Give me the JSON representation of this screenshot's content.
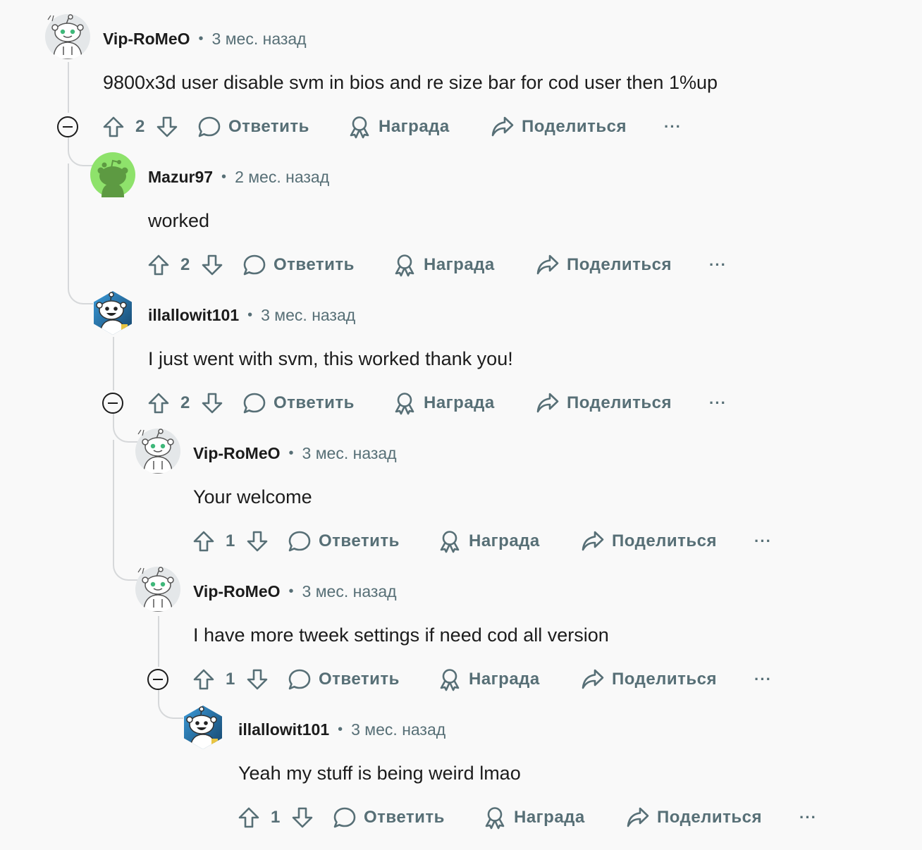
{
  "labels": {
    "separator": "•",
    "reply": "Ответить",
    "award": "Награда",
    "share": "Поделиться",
    "more": "···"
  },
  "comments": [
    {
      "author": "Vip-RoMeO",
      "time": "3 мес. назад",
      "text": "9800x3d user disable svm in bios and re size bar for cod user then 1%up",
      "score": "2",
      "avatar": "snoo-white-icon"
    },
    {
      "author": "Mazur97",
      "time": "2 мес. назад",
      "text": "worked",
      "score": "2",
      "avatar": "snoo-green-icon"
    },
    {
      "author": "illallowit101",
      "time": "3 мес. назад",
      "text": "I just went with svm, this worked thank you!",
      "score": "2",
      "avatar": "snoo-hexagon-icon"
    },
    {
      "author": "Vip-RoMeO",
      "time": "3 мес. назад",
      "text": "Your welcome",
      "score": "1",
      "avatar": "snoo-white-icon"
    },
    {
      "author": "Vip-RoMeO",
      "time": "3 мес. назад",
      "text": "I have more tweek settings if need cod all version",
      "score": "1",
      "avatar": "snoo-white-icon"
    },
    {
      "author": "illallowit101",
      "time": "3 мес. назад",
      "text": "Yeah my stuff is being weird lmao",
      "score": "1",
      "avatar": "snoo-hexagon-icon"
    }
  ],
  "colors": {
    "background": "#f9f9f9",
    "text": "#1c1c1c",
    "meta": "#576f76",
    "thread_line": "#d6d8da",
    "avatar_green": "#8ee26b"
  }
}
